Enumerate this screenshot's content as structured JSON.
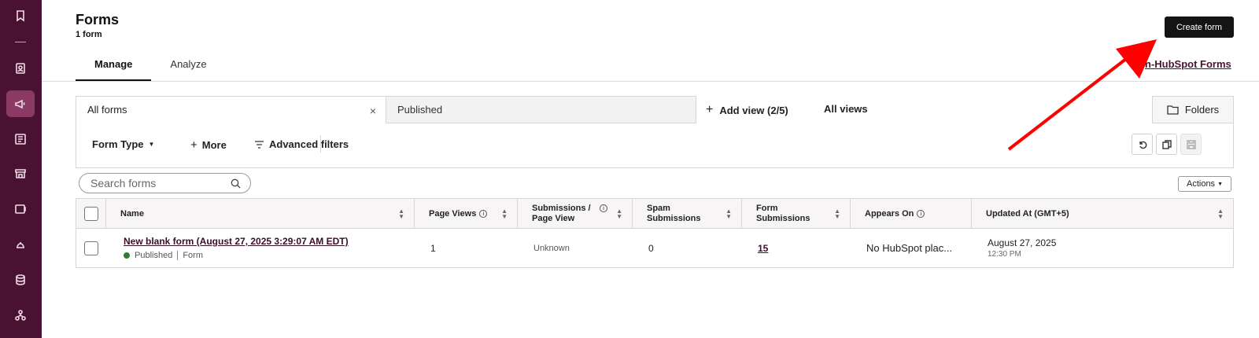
{
  "header": {
    "title": "Forms",
    "count": "1 form",
    "create_button": "Create form",
    "non_hubspot_link": "n-HubSpot Forms"
  },
  "tabs": [
    {
      "label": "Manage",
      "active": true
    },
    {
      "label": "Analyze",
      "active": false
    }
  ],
  "views": {
    "active": {
      "label": "All forms",
      "close": "×"
    },
    "inactive": {
      "label": "Published"
    },
    "add_view": "Add view (2/5)",
    "all_views": "All views",
    "folders": "Folders"
  },
  "filters": {
    "form_type": "Form Type",
    "more": "More",
    "advanced": "Advanced filters"
  },
  "search": {
    "placeholder": "Search forms"
  },
  "actions_button": "Actions",
  "table": {
    "columns": [
      "Name",
      "Page Views",
      "Submissions / Page View",
      "Spam Submissions",
      "Form Submissions",
      "Appears On",
      "Updated At (GMT+5)"
    ],
    "rows": [
      {
        "name": "New blank form (August 27, 2025 3:29:07 AM EDT)",
        "status": "Published",
        "type": "Form",
        "page_views": "1",
        "submissions_per_view": "Unknown",
        "spam": "0",
        "form_submissions": "15",
        "appears_on": "No HubSpot plac...",
        "updated_date": "August 27, 2025",
        "updated_time": "12:30 PM"
      }
    ]
  },
  "colors": {
    "sidebar": "#4a1232",
    "sidebar_active": "#8a3a64",
    "primary_button": "#141414",
    "status_published": "#2e7d32",
    "annotation_arrow": "#ff0000"
  },
  "sidebar_icons": [
    "bookmark-icon",
    "contacts-icon",
    "marketing-megaphone-icon",
    "content-icon",
    "commerce-store-icon",
    "sales-wallet-icon",
    "service-icon",
    "data-database-icon",
    "automation-tree-icon"
  ]
}
